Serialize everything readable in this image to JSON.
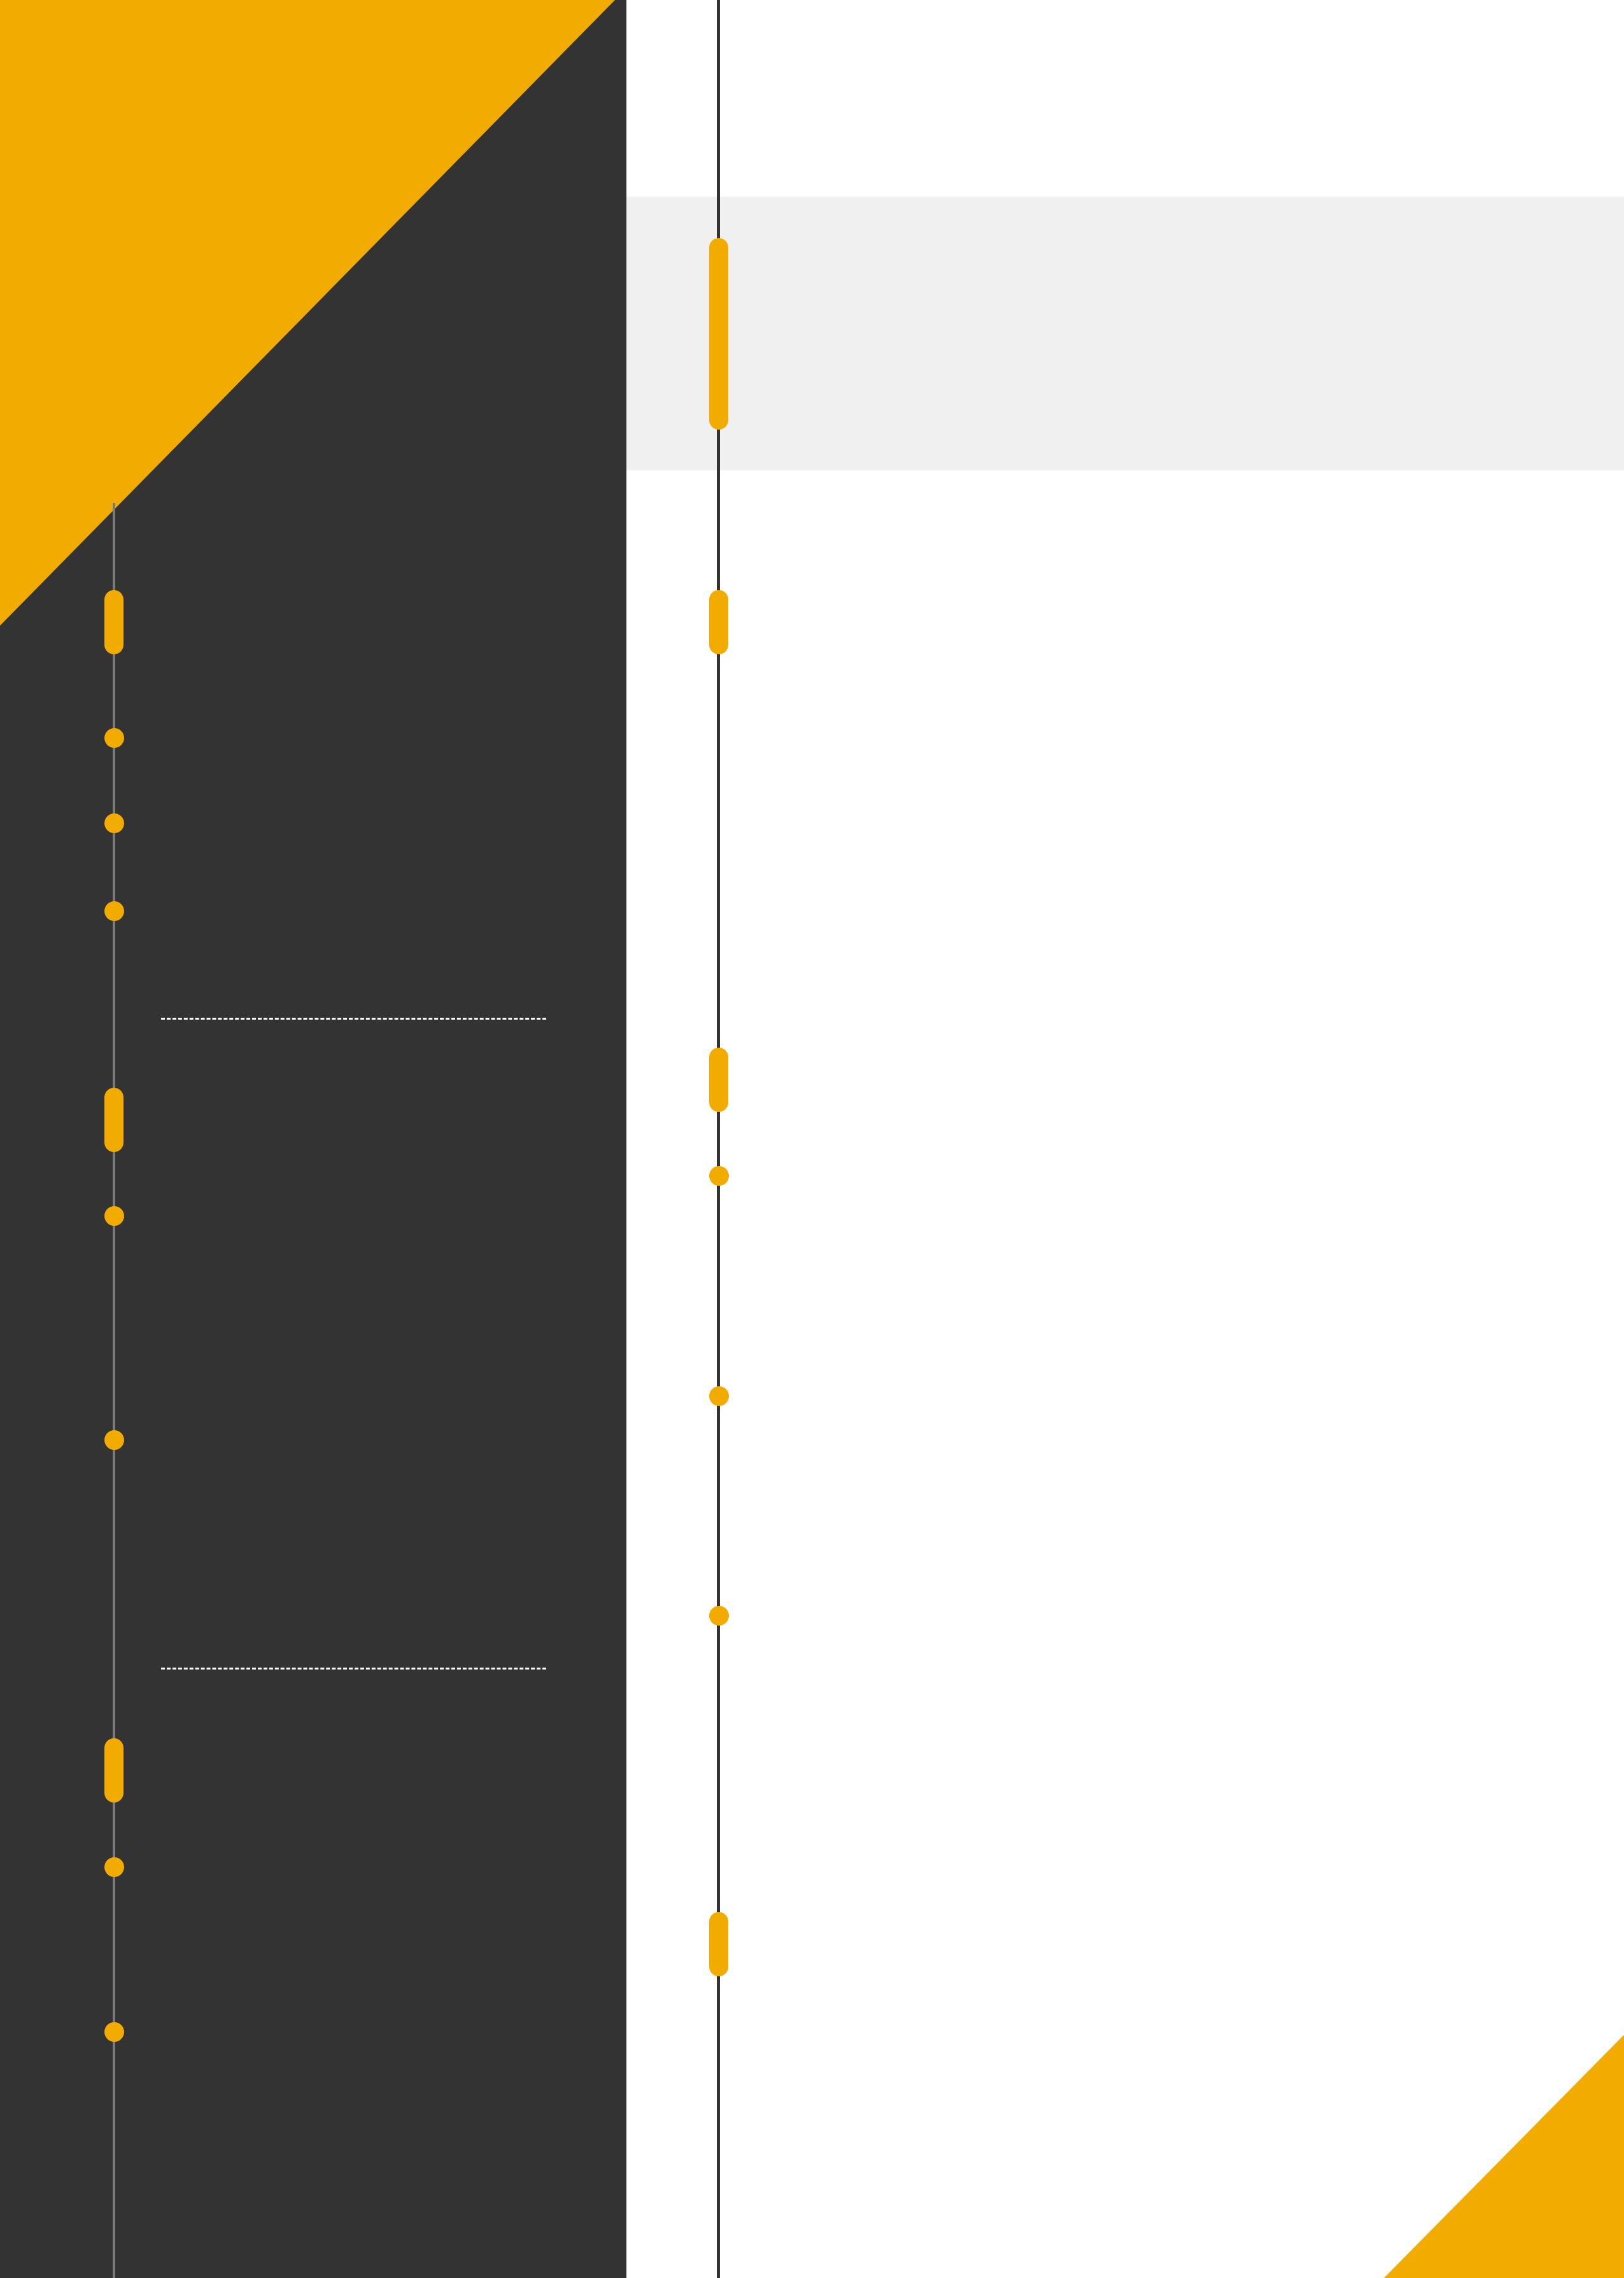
{
  "colors": {
    "accent": "#f2ab00",
    "sidebar": "#333333",
    "header_band": "#f0f0f0",
    "sidebar_line": "#7a7a7a",
    "main_line": "#333333",
    "background": "#ffffff"
  },
  "sidebar": {
    "sections": 3,
    "dividers": 2
  },
  "main": {
    "sections": 4
  }
}
